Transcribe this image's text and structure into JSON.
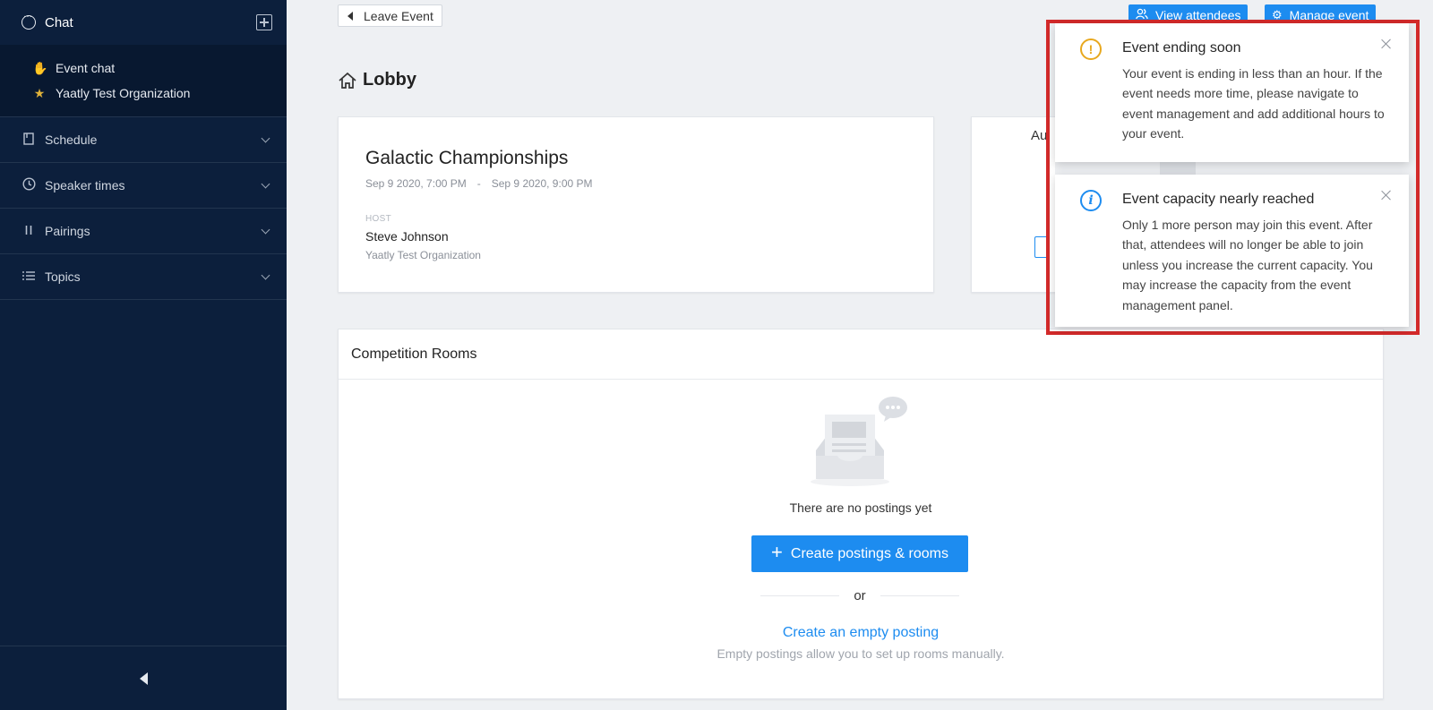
{
  "sidebar": {
    "header_title": "Chat",
    "channels": [
      {
        "label": "Event chat",
        "icon": "clap-icon"
      },
      {
        "label": "Yaatly Test Organization",
        "icon": "star-icon"
      }
    ],
    "sections": [
      {
        "label": "Schedule",
        "icon": "book-icon"
      },
      {
        "label": "Speaker times",
        "icon": "clock-icon"
      },
      {
        "label": "Pairings",
        "icon": "pause-bars-icon"
      },
      {
        "label": "Topics",
        "icon": "list-icon"
      }
    ]
  },
  "toolbar": {
    "leave_label": "Leave Event",
    "view_attendees_label": "View attendees",
    "manage_event_label": "Manage event"
  },
  "lobby": {
    "title": "Lobby"
  },
  "event": {
    "name": "Galactic Championships",
    "start": "Sep 9 2020, 7:00 PM",
    "separator": "-",
    "end": "Sep 9 2020, 9:00 PM",
    "host_label": "HOST",
    "host_name": "Steve Johnson",
    "host_org": "Yaatly Test Organization"
  },
  "side_card": {
    "partial_text": "Au"
  },
  "rooms": {
    "title": "Competition Rooms",
    "empty_text": "There are no postings yet",
    "create_label": "Create postings & rooms",
    "or_label": "or",
    "empty_link": "Create an empty posting",
    "empty_hint": "Empty postings allow you to set up rooms manually."
  },
  "notifications": [
    {
      "type": "warning",
      "icon_glyph": "!",
      "title": "Event ending soon",
      "body": "Your event is ending in less than an hour. If the event needs more time, please navigate to event management and add additional hours to your event."
    },
    {
      "type": "info",
      "icon_glyph": "i",
      "title": "Event capacity nearly reached",
      "body": "Only 1 more person may join this event. After that, attendees will no longer be able to join unless you increase the current capacity. You may increase the capacity from the event management panel."
    }
  ],
  "colors": {
    "sidebar_bg": "#0c1f3c",
    "accent": "#1d8cf0",
    "warning": "#e8a81e",
    "highlight_border": "#d32a2a"
  }
}
